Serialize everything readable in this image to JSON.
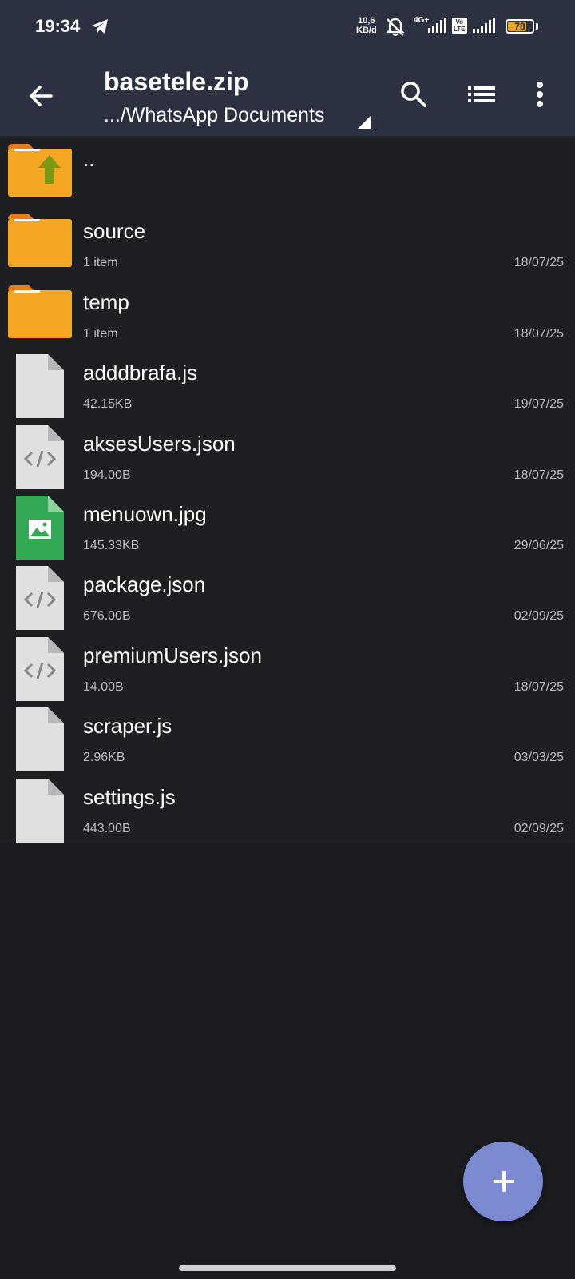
{
  "status_bar": {
    "time": "19:34",
    "net_speed_value": "10,6",
    "net_speed_unit": "KB/d",
    "network_type": "4G+",
    "volte_label_1": "Vo",
    "volte_label_2": "LTE",
    "battery_level": "78",
    "battery_fraction": 0.78,
    "battery_color": "#e6a52a"
  },
  "app_bar": {
    "title": "basetele.zip",
    "subtitle": ".../WhatsApp Documents",
    "back_icon": "arrow-left-icon",
    "search_icon": "search-icon",
    "view_icon": "list-view-icon",
    "more_icon": "more-vert-icon",
    "background": "#2c3141"
  },
  "files": [
    {
      "name": "..",
      "meta": "",
      "date": "",
      "icon": "folder-up-icon"
    },
    {
      "name": "source",
      "meta": "1 item",
      "date": "18/07/25",
      "icon": "folder-icon"
    },
    {
      "name": "temp",
      "meta": "1 item",
      "date": "18/07/25",
      "icon": "folder-icon"
    },
    {
      "name": "adddbrafa.js",
      "meta": "42.15KB",
      "date": "19/07/25",
      "icon": "file-icon"
    },
    {
      "name": "aksesUsers.json",
      "meta": "194.00B",
      "date": "18/07/25",
      "icon": "code-file-icon"
    },
    {
      "name": "menuown.jpg",
      "meta": "145.33KB",
      "date": "29/06/25",
      "icon": "image-file-icon"
    },
    {
      "name": "package.json",
      "meta": "676.00B",
      "date": "02/09/25",
      "icon": "code-file-icon"
    },
    {
      "name": "premiumUsers.json",
      "meta": "14.00B",
      "date": "18/07/25",
      "icon": "code-file-icon"
    },
    {
      "name": "scraper.js",
      "meta": "2.96KB",
      "date": "03/03/25",
      "icon": "file-icon"
    },
    {
      "name": "settings.js",
      "meta": "443.00B",
      "date": "02/09/25",
      "icon": "file-icon"
    }
  ],
  "fab": {
    "icon": "plus-icon",
    "color": "#7b89d1"
  },
  "colors": {
    "folder": "#f5a623",
    "folder_tab": "#f07b12",
    "up_arrow": "#7a9a13",
    "image_file": "#33a852",
    "file": "#e0e0e0"
  }
}
